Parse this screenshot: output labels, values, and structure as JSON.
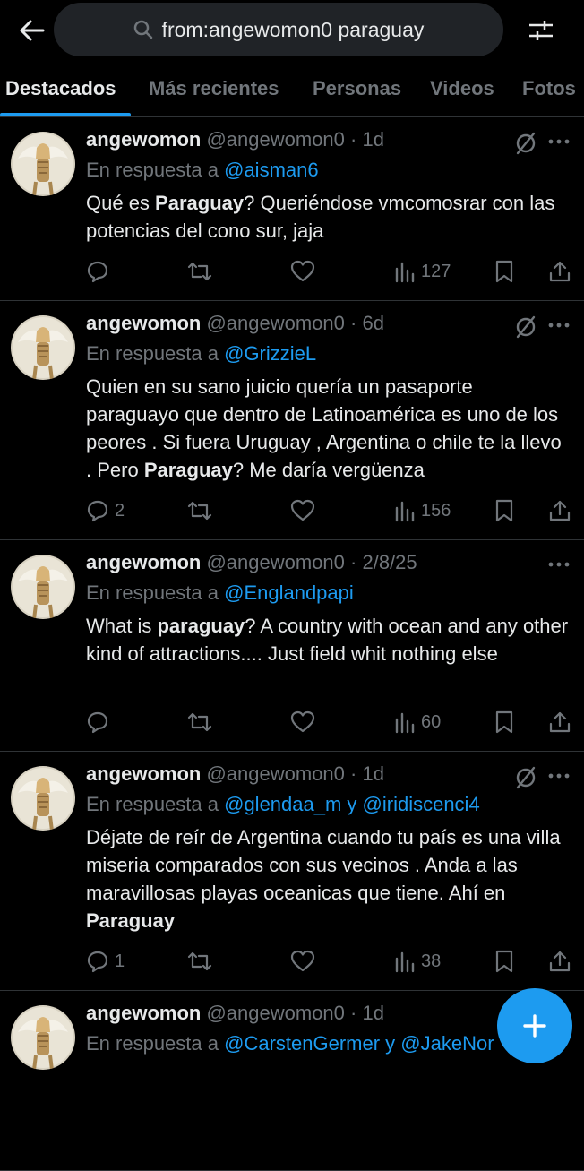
{
  "search": {
    "query": "from:angewomon0 paraguay"
  },
  "tabs": [
    {
      "label": "Destacados"
    },
    {
      "label": "Más recientes"
    },
    {
      "label": "Personas"
    },
    {
      "label": "Videos"
    },
    {
      "label": "Fotos"
    }
  ],
  "tweets": [
    {
      "name": "angewomon",
      "handle": "@angewomon0",
      "time": "1d",
      "reply_prefix": "En respuesta a",
      "reply_to": "@aisman6",
      "text_parts": [
        [
          "Qué es ",
          ""
        ],
        [
          "Paraguay",
          "b"
        ],
        [
          "? Queriéndose vmcomosrar con las potencias del cono sur, jaja",
          ""
        ]
      ],
      "replies": "",
      "views": "127"
    },
    {
      "name": "angewomon",
      "handle": "@angewomon0",
      "time": "6d",
      "reply_prefix": "En respuesta a",
      "reply_to": "@GrizzieL",
      "text_parts": [
        [
          "Quien en su sano juicio quería un pasaporte paraguayo que dentro de Latinoamérica es uno de los peores . Si fuera Uruguay , Argentina o chile te la llevo .  Pero ",
          ""
        ],
        [
          "Paraguay",
          "b"
        ],
        [
          "? Me daría vergüenza",
          ""
        ]
      ],
      "replies": "2",
      "views": "156"
    },
    {
      "name": "angewomon",
      "handle": "@angewomon0",
      "time": "2/8/25",
      "reply_prefix": "En respuesta a",
      "reply_to": "@Englandpapi",
      "text_parts": [
        [
          "What is ",
          ""
        ],
        [
          "paraguay",
          "b"
        ],
        [
          "? A country with ocean and any other kind of attractions.... Just field whit nothing else",
          ""
        ]
      ],
      "replies": "",
      "views": "60"
    },
    {
      "name": "angewomon",
      "handle": "@angewomon0",
      "time": "1d",
      "reply_prefix": "En respuesta a",
      "reply_to": "@glendaa_m y @iridiscenci4",
      "text_parts": [
        [
          "Déjate de reír de Argentina cuando tu país es una villa miseria comparados con sus vecinos . Anda a las maravillosas playas oceanicas que tiene. Ahí en ",
          ""
        ],
        [
          "Paraguay",
          "b"
        ]
      ],
      "replies": "1",
      "views": "38"
    },
    {
      "name": "angewomon",
      "handle": "@angewomon0",
      "time": "1d",
      "reply_prefix": "En respuesta a",
      "reply_to": "@CarstenGermer y @JakeNor",
      "text_parts": [],
      "replies": "",
      "views": ""
    }
  ]
}
